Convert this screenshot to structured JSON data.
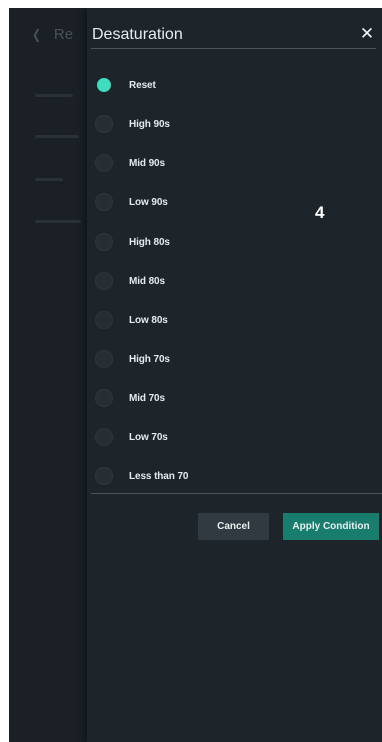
{
  "background": {
    "back_label": "Re",
    "back_icon": "chevron-left-icon"
  },
  "modal": {
    "title": "Desaturation",
    "close_icon": "close-icon",
    "close_glyph": "✕",
    "options": [
      {
        "label": "Reset",
        "selected": true
      },
      {
        "label": "High 90s",
        "selected": false
      },
      {
        "label": "Mid 90s",
        "selected": false
      },
      {
        "label": "Low 90s",
        "selected": false
      },
      {
        "label": "High 80s",
        "selected": false
      },
      {
        "label": "Mid 80s",
        "selected": false
      },
      {
        "label": "Low 80s",
        "selected": false
      },
      {
        "label": "High 70s",
        "selected": false
      },
      {
        "label": "Mid 70s",
        "selected": false
      },
      {
        "label": "Low 70s",
        "selected": false
      },
      {
        "label": "Less than 70",
        "selected": false
      }
    ],
    "step_number": "4",
    "cancel_label": "Cancel",
    "apply_label": "Apply Condition"
  },
  "colors": {
    "accent": "#3fdcbf",
    "apply_button": "#187d6d",
    "cancel_button": "#313a41",
    "modal_background": "#1e252a"
  }
}
